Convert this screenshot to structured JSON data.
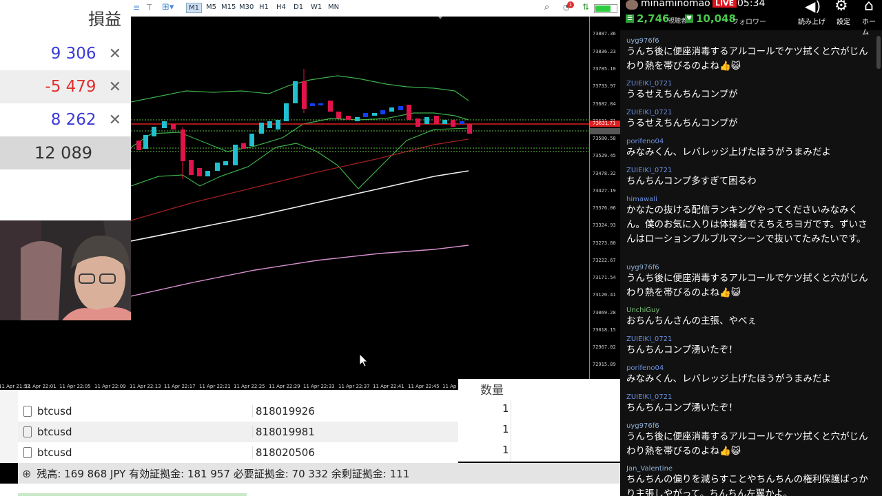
{
  "pnl": {
    "header": "損益",
    "rows": [
      {
        "value": "9 306",
        "color": "#3a3ad8",
        "close": "✕"
      },
      {
        "value": "-5 479",
        "color": "#e03030",
        "close": "✕"
      },
      {
        "value": "8 262",
        "color": "#3a3ad8",
        "close": "✕"
      }
    ],
    "total": "12 089"
  },
  "toolbar": {
    "timeframes": [
      "M1",
      "M5",
      "M15",
      "M30",
      "H1",
      "H4",
      "D1",
      "W1",
      "MN"
    ],
    "active": "M1",
    "notif_count": "1"
  },
  "chart": {
    "y_ticks": [
      "73887.36",
      "73836.23",
      "73785.10",
      "73733.97",
      "73682.84",
      "73631.71",
      "73580.58",
      "73529.45",
      "73478.32",
      "73427.19",
      "73376.06",
      "73324.93",
      "73273.80",
      "73222.67",
      "73171.54",
      "73120.41",
      "73069.28",
      "73018.15",
      "72967.02",
      "72915.89"
    ],
    "price_label": "73631.71",
    "x_ticks": [
      "11 Apr 21:57",
      "11 Apr 22:01",
      "11 Apr 22:05",
      "11 Apr 22:09",
      "11 Apr 22:13",
      "11 Apr 22:17",
      "11 Apr 22:21",
      "11 Apr 22:25",
      "11 Apr 22:29",
      "11 Apr 22:33",
      "11 Apr 22:37",
      "11 Apr 22:41",
      "11 Apr 22:45",
      "11 Ap"
    ]
  },
  "table": {
    "rows": [
      {
        "symbol": "btcusd",
        "order": "818019926",
        "qty": "1"
      },
      {
        "symbol": "btcusd",
        "order": "818019981",
        "qty": "1"
      },
      {
        "symbol": "btcusd",
        "order": "818020506",
        "qty": "1"
      }
    ],
    "qty_header": "数量",
    "summary_icon": "⊕",
    "summary": "残高: 169 868 JPY  有効証拠金: 181 957  必要証拠金: 70 332  余剰証拠金: 111"
  },
  "stream": {
    "channel": "minaminomao",
    "live": "LIVE",
    "time": "05:34",
    "viewers": "2,746",
    "viewers_label": "視聴者",
    "followers": "10,048",
    "followers_label": "フォロワー",
    "buttons": [
      {
        "label": "読み上げ",
        "icon": "speaker-icon"
      },
      {
        "label": "設定",
        "icon": "gear-icon"
      },
      {
        "label": "ホーム",
        "icon": "home-icon"
      }
    ],
    "chat": [
      {
        "user": "uyg976f6",
        "color": "#8fb0d8",
        "msg": "うんち後に便座消毒するアルコールでケツ拭くと穴がじんわり熱を帯びるのよね👍😺"
      },
      {
        "user": "ZUIEIKI_0721",
        "color": "#6a8ee0",
        "msg": "うるせえちんちんコンプが"
      },
      {
        "user": "ZUIEIKI_0721",
        "color": "#6a8ee0",
        "msg": "うるせえちんちんコンプが"
      },
      {
        "user": "porifeno04",
        "color": "#6a8ee0",
        "msg": "みなみくん、レバレッジ上げたほうがうまみだよ"
      },
      {
        "user": "ZUIEIKI_0721",
        "color": "#6a8ee0",
        "msg": "ちんちんコンプ多すぎて困るわ"
      },
      {
        "user": "himawali",
        "color": "#6a8ee0",
        "msg": "かなたの抜ける配信ランキングやってくださいみなみくん。僕のお気に入りは体操着でえちえちヨガです。ずいさんはローションブルブルマシーンで抜いてたみたいです。"
      },
      {
        "user": "uyg976f6",
        "color": "#8fb0d8",
        "msg": "うんち後に便座消毒するアルコールでケツ拭くと穴がじんわり熱を帯びるのよね👍😺"
      },
      {
        "user": "UnchiGuy",
        "color": "#7ac07a",
        "msg": "おちんちんさんの主張、やべぇ"
      },
      {
        "user": "ZUIEIKI_0721",
        "color": "#6a8ee0",
        "msg": "ちんちんコンプ湧いたぞ！"
      },
      {
        "user": "porifeno04",
        "color": "#6a8ee0",
        "msg": "みなみくん、レバレッジ上げたほうがうまみだよ"
      },
      {
        "user": "ZUIEIKI_0721",
        "color": "#6a8ee0",
        "msg": "ちんちんコンプ湧いたぞ！"
      },
      {
        "user": "uyg976f6",
        "color": "#8fb0d8",
        "msg": "うんち後に便座消毒するアルコールでケツ拭くと穴がじんわり熱を帯びるのよね👍😺"
      },
      {
        "user": "Jan_Valentine",
        "color": "#8fb0d8",
        "msg": "ちんちんの偏りを減らすことやちんちんの権利保護ばっかり主張しやがって。ちんちん左翼かよ。"
      }
    ]
  }
}
